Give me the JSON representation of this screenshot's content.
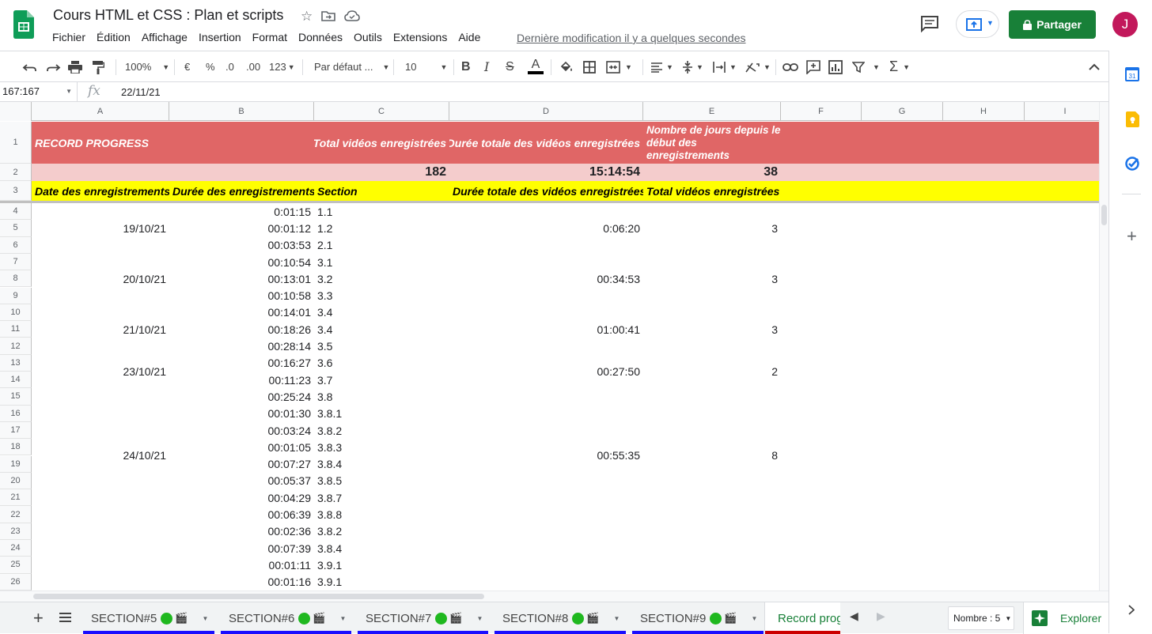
{
  "doc": {
    "title": "Cours HTML et CSS : Plan et scripts",
    "last_edit": "Dernière modification il y a quelques secondes"
  },
  "menu": [
    "Fichier",
    "Édition",
    "Affichage",
    "Insertion",
    "Format",
    "Données",
    "Outils",
    "Extensions",
    "Aide"
  ],
  "share": {
    "label": "Partager"
  },
  "user": {
    "initial": "J"
  },
  "toolbar": {
    "zoom": "100%",
    "currency": "€",
    "percent": "%",
    "dec_less": ".0",
    "dec_more": ".00",
    "format_more": "123",
    "font": "Par défaut ...",
    "font_size": "10"
  },
  "formula": {
    "cell_ref": "167:167",
    "fx": "fx",
    "value": "22/11/21"
  },
  "columns": [
    "A",
    "B",
    "C",
    "D",
    "E",
    "F",
    "G",
    "H",
    "I"
  ],
  "header_row": {
    "a": "RECORD PROGRESS",
    "c": "Total vidéos enregistrées",
    "d": "Durée totale des vidéos enregistrées",
    "e": "Nombre de jours depuis le début des enregistrements"
  },
  "totals_row": {
    "c": "182",
    "d": "15:14:54",
    "e": "38"
  },
  "subheader_row": {
    "a": "Date des enregistrements",
    "b": "Durée des enregistrements",
    "c": "Section",
    "d": "Durée totale des vidéos enregistrées",
    "e": "Total vidéos enregistrées"
  },
  "rows": [
    {
      "n": "4",
      "b": "0:01:15",
      "c": "1.1"
    },
    {
      "n": "5",
      "b": "00:01:12",
      "c": "1.2"
    },
    {
      "n": "6",
      "b": "00:03:53",
      "c": "2.1"
    },
    {
      "n": "7",
      "b": "00:10:54",
      "c": "3.1"
    },
    {
      "n": "8",
      "b": "00:13:01",
      "c": "3.2"
    },
    {
      "n": "9",
      "b": "00:10:58",
      "c": "3.3"
    },
    {
      "n": "10",
      "b": "00:14:01",
      "c": "3.4"
    },
    {
      "n": "11",
      "b": "00:18:26",
      "c": "3.4"
    },
    {
      "n": "12",
      "b": "00:28:14",
      "c": "3.5"
    },
    {
      "n": "13",
      "b": "00:16:27",
      "c": "3.6"
    },
    {
      "n": "14",
      "b": "00:11:23",
      "c": "3.7"
    },
    {
      "n": "15",
      "b": "00:25:24",
      "c": "3.8"
    },
    {
      "n": "16",
      "b": "00:01:30",
      "c": "3.8.1"
    },
    {
      "n": "17",
      "b": "00:03:24",
      "c": "3.8.2"
    },
    {
      "n": "18",
      "b": "00:01:05",
      "c": "3.8.3"
    },
    {
      "n": "19",
      "b": "00:07:27",
      "c": "3.8.4"
    },
    {
      "n": "20",
      "b": "00:05:37",
      "c": "3.8.5"
    },
    {
      "n": "21",
      "b": "00:04:29",
      "c": "3.8.7"
    },
    {
      "n": "22",
      "b": "00:06:39",
      "c": "3.8.8"
    },
    {
      "n": "23",
      "b": "00:02:36",
      "c": "3.8.2"
    },
    {
      "n": "24",
      "b": "00:07:39",
      "c": "3.8.4"
    },
    {
      "n": "25",
      "b": "00:01:11",
      "c": "3.9.1"
    },
    {
      "n": "26",
      "b": "00:01:16",
      "c": "3.9.1"
    }
  ],
  "groups": [
    {
      "first": 1,
      "last": 3,
      "date": "19/10/21",
      "total": "0:06:20",
      "count": "3"
    },
    {
      "first": 4,
      "last": 6,
      "date": "20/10/21",
      "total": "00:34:53",
      "count": "3"
    },
    {
      "first": 7,
      "last": 9,
      "date": "21/10/21",
      "total": "01:00:41",
      "count": "3"
    },
    {
      "first": 10,
      "last": 11,
      "date": "23/10/21",
      "total": "00:27:50",
      "count": "2"
    },
    {
      "first": 12,
      "last": 19,
      "date": "24/10/21",
      "total": "00:55:35",
      "count": "8"
    }
  ],
  "sheets": [
    {
      "label": "SECTION#5",
      "emoji": "🎬"
    },
    {
      "label": "SECTION#6",
      "emoji": "🎬"
    },
    {
      "label": "SECTION#7",
      "emoji": "🎬"
    },
    {
      "label": "SECTION#8",
      "emoji": "🎬"
    },
    {
      "label": "SECTION#9",
      "emoji": "🎬"
    },
    {
      "label": "Record progress",
      "emoji": ""
    }
  ],
  "stats": {
    "label": "Nombre : 5"
  },
  "explore": {
    "label": "Explorer"
  },
  "colors": {
    "header_red": "#e06666",
    "totals_pink": "#f4cccc",
    "yellow": "#ffff00",
    "tab_blue": "#1a0dff",
    "tab_red": "#cc0000",
    "green": "#188038"
  }
}
